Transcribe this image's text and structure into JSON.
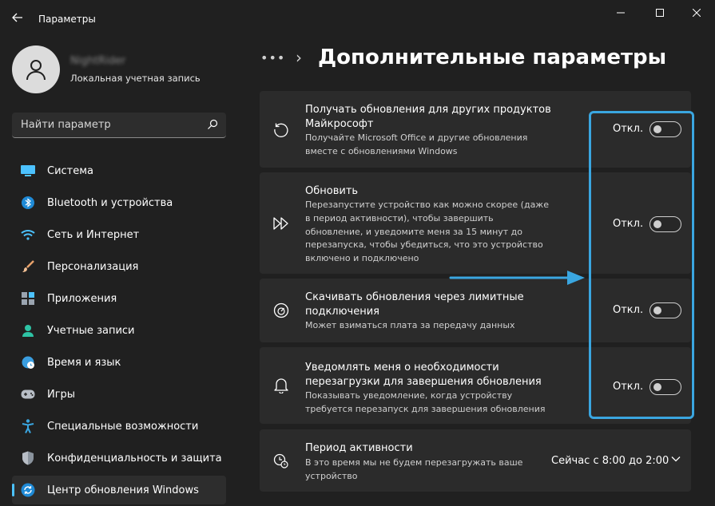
{
  "window": {
    "title": "Параметры"
  },
  "user": {
    "name": "NightRider",
    "account_type": "Локальная учетная запись"
  },
  "search": {
    "placeholder": "Найти параметр"
  },
  "sidebar": {
    "items": [
      {
        "label": "Система",
        "icon": "monitor-icon",
        "active": false
      },
      {
        "label": "Bluetooth и устройства",
        "icon": "bluetooth-icon",
        "active": false
      },
      {
        "label": "Сеть и Интернет",
        "icon": "wifi-icon",
        "active": false
      },
      {
        "label": "Персонализация",
        "icon": "brush-icon",
        "active": false
      },
      {
        "label": "Приложения",
        "icon": "apps-icon",
        "active": false
      },
      {
        "label": "Учетные записи",
        "icon": "person-icon",
        "active": false
      },
      {
        "label": "Время и язык",
        "icon": "globe-clock-icon",
        "active": false
      },
      {
        "label": "Игры",
        "icon": "gamepad-icon",
        "active": false
      },
      {
        "label": "Специальные возможности",
        "icon": "accessibility-icon",
        "active": false
      },
      {
        "label": "Конфиденциальность и защита",
        "icon": "shield-icon",
        "active": false
      },
      {
        "label": "Центр обновления Windows",
        "icon": "update-icon",
        "active": true
      }
    ]
  },
  "breadcrumb": {
    "more": "•••",
    "separator": "›",
    "title": "Дополнительные параметры"
  },
  "settings": [
    {
      "title": "Получать обновления для других продуктов Майкрософт",
      "description": "Получайте Microsoft Office и другие обновления вместе с обновлениями Windows",
      "state": "Откл.",
      "icon": "history-icon"
    },
    {
      "title": "Обновить",
      "description": "Перезапустите устройство как можно скорее (даже в период активности), чтобы завершить обновление, и уведомите меня за 15 минут до перезапуска, чтобы убедиться, что это устройство включено и подключено",
      "state": "Откл.",
      "icon": "fast-forward-icon"
    },
    {
      "title": "Скачивать обновления через лимитные подключения",
      "description": "Может взиматься плата за передачу данных",
      "state": "Откл.",
      "icon": "speedometer-icon"
    },
    {
      "title": "Уведомлять меня о необходимости перезагрузки для завершения обновления",
      "description": "Показывать уведомление, когда устройству требуется перезапуск для завершения обновления",
      "state": "Откл.",
      "icon": "bell-icon"
    }
  ],
  "active_hours": {
    "title": "Период активности",
    "description": "В это время мы не будем перезагружать ваше устройство",
    "value": "Сейчас с 8:00 до 2:00",
    "icon": "active-hours-icon"
  },
  "colors": {
    "accent": "#4cc2ff",
    "highlight": "#3aa6e0",
    "background": "#202020",
    "card": "#2b2b2b"
  }
}
